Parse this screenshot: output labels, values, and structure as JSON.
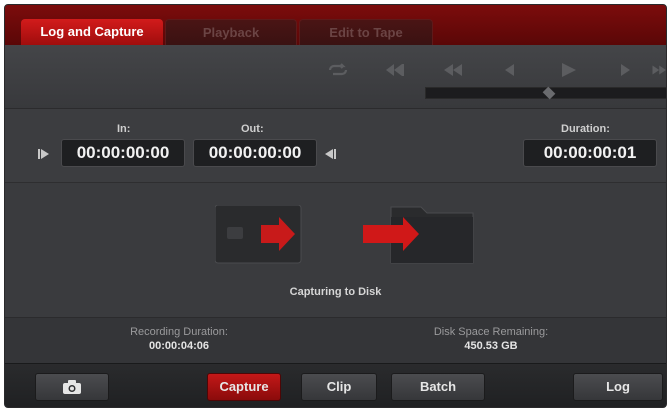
{
  "tabs": [
    {
      "label": "Log and Capture",
      "active": true
    },
    {
      "label": "Playback",
      "active": false
    },
    {
      "label": "Edit to Tape",
      "active": false
    }
  ],
  "transport": {
    "buttons": [
      "loop-icon",
      "rewind-fast-icon",
      "rewind-icon",
      "step-back-icon",
      "play-icon",
      "step-forward-icon",
      "fast-forward-icon"
    ],
    "jog_position": 0.51
  },
  "timecode": {
    "in_label": "In:",
    "in_value": "00:00:00:00",
    "out_label": "Out:",
    "out_value": "00:00:00:00",
    "duration_label": "Duration:",
    "duration_value": "00:00:00:01"
  },
  "capture": {
    "status": "Capturing to Disk"
  },
  "info": {
    "recording_label": "Recording Duration:",
    "recording_value": "00:00:04:06",
    "disk_label": "Disk Space Remaining:",
    "disk_value": "450.53 GB"
  },
  "bottom": {
    "camera_icon": "camera-icon",
    "capture_label": "Capture",
    "clip_label": "Clip",
    "batch_label": "Batch",
    "log_label": "Log"
  },
  "colors": {
    "accent": "#c31818",
    "panel": "#3a3b3e"
  }
}
